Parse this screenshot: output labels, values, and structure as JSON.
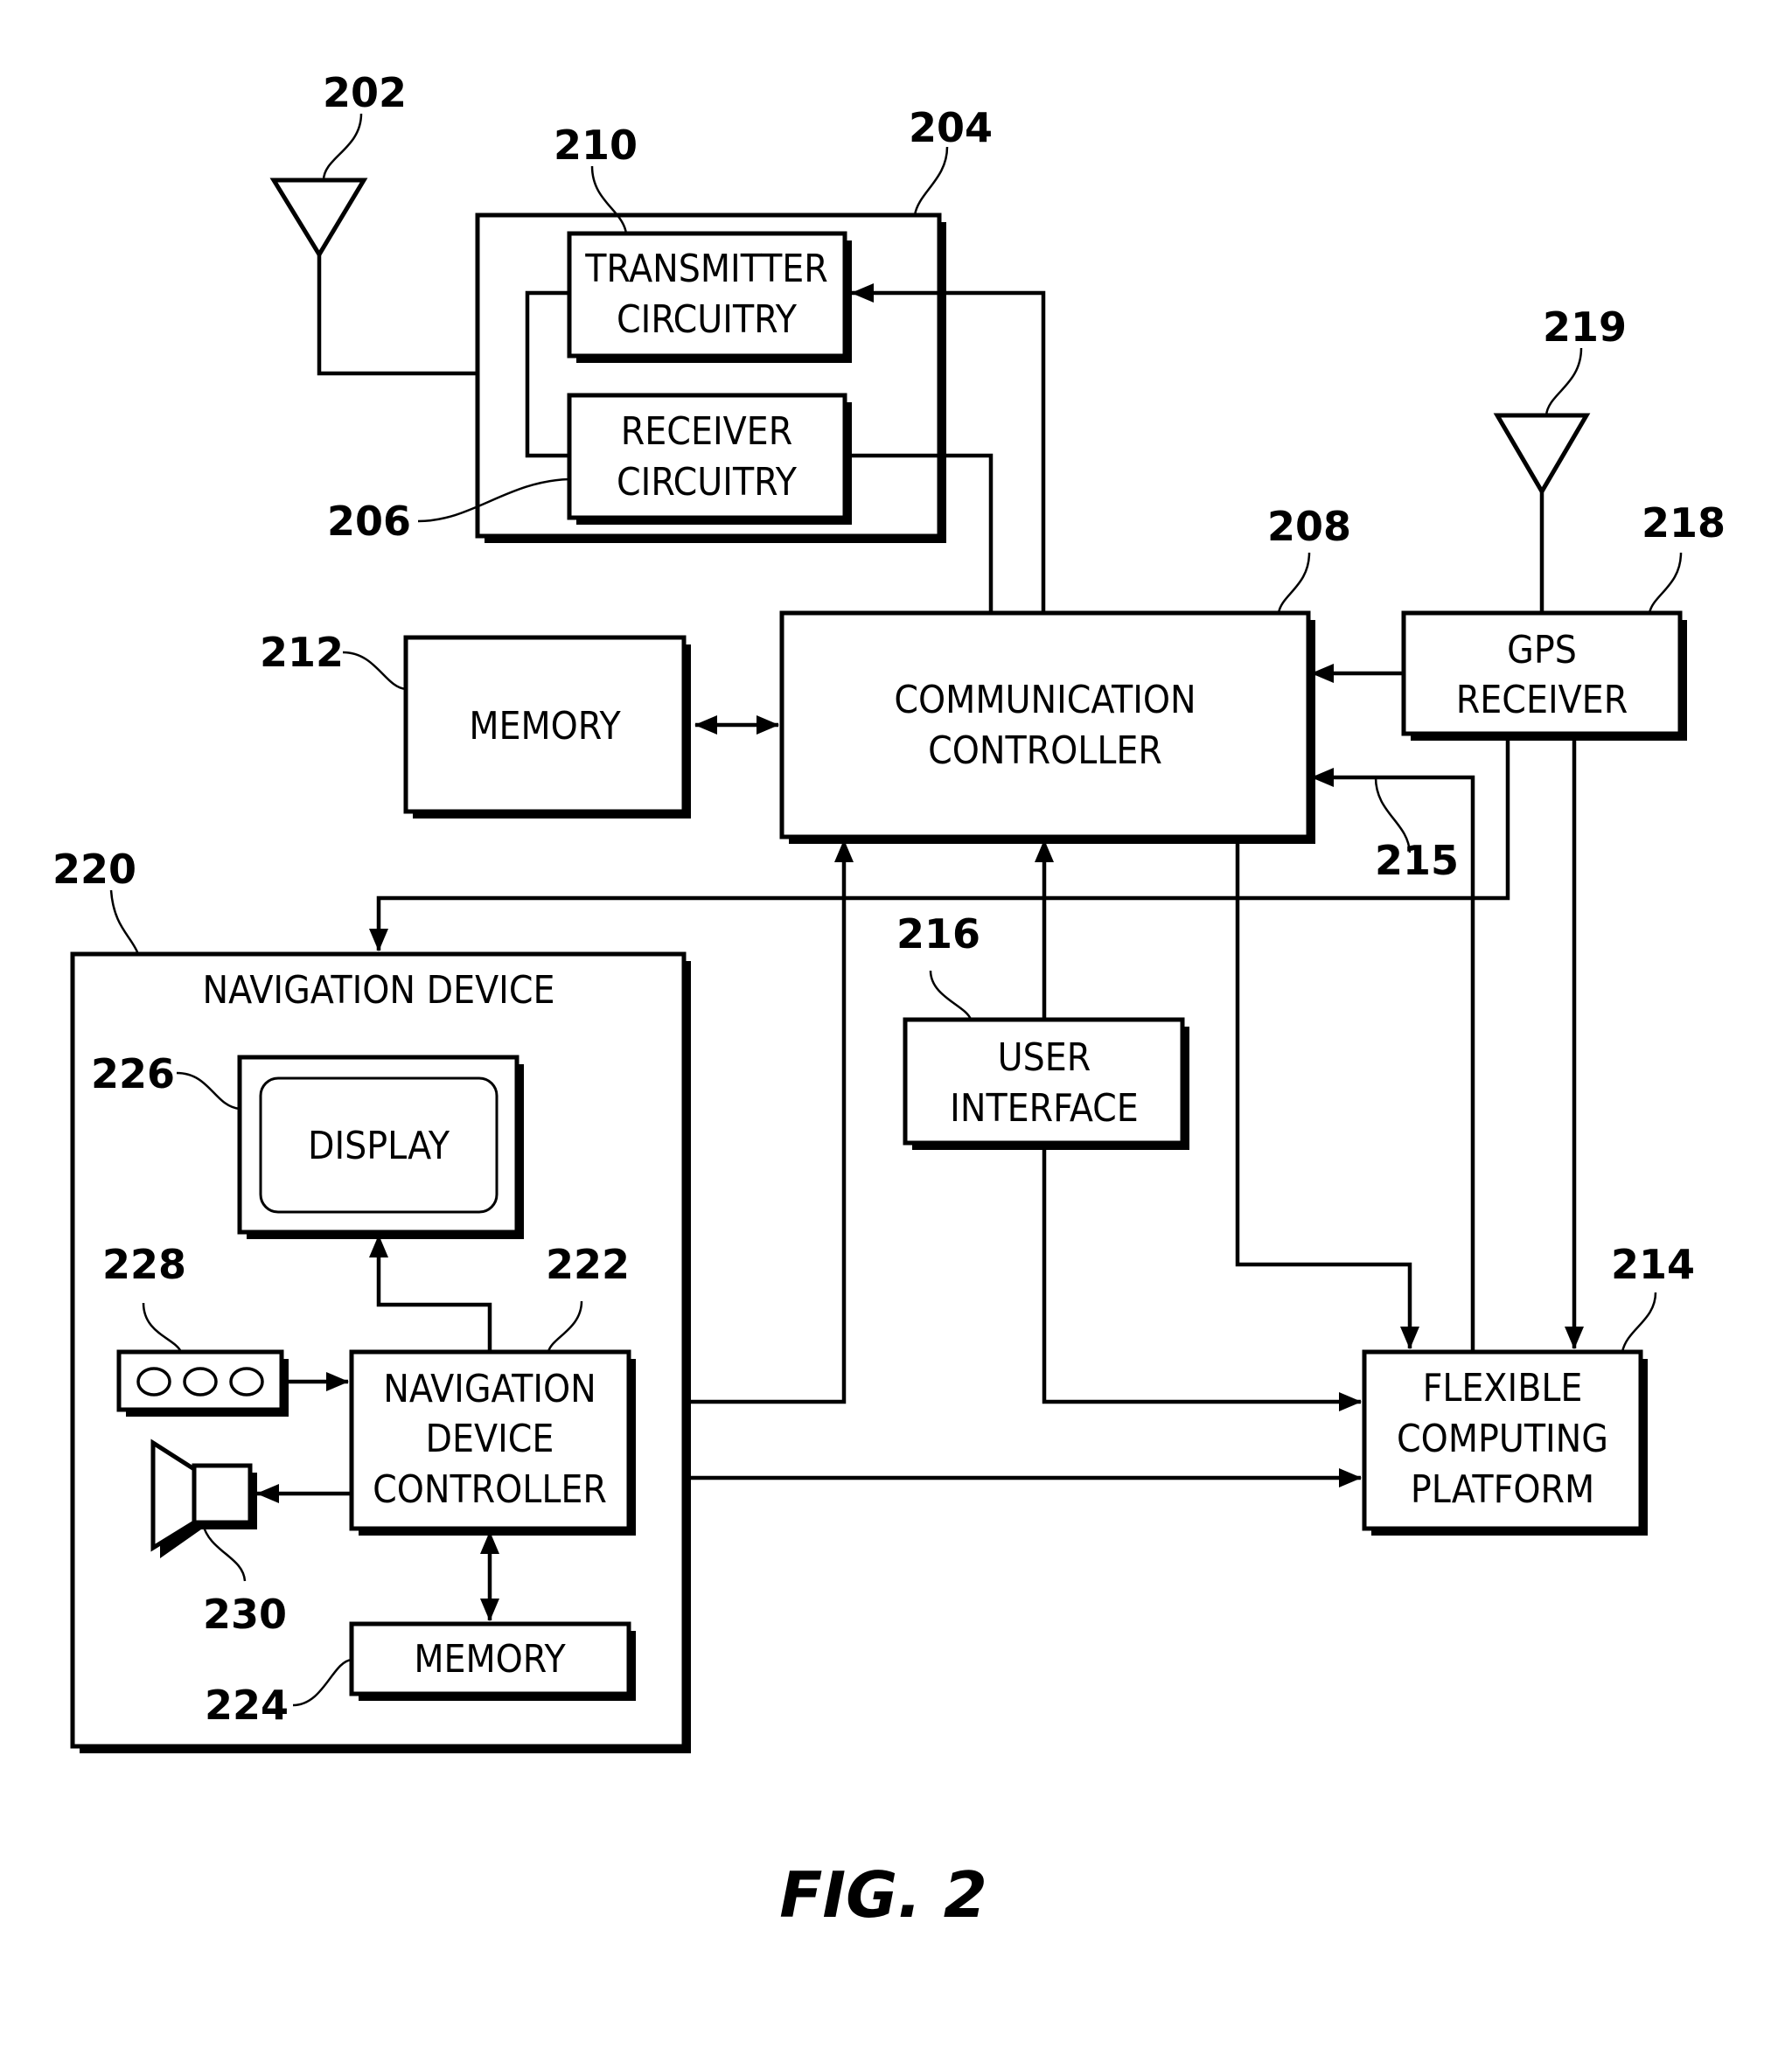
{
  "figure": {
    "caption": "FIG. 2"
  },
  "blocks": {
    "transmitter": {
      "ref": "210",
      "line1": "TRANSMITTER",
      "line2": "CIRCUITRY"
    },
    "receiver": {
      "ref": "206",
      "line1": "RECEIVER",
      "line2": "CIRCUITRY"
    },
    "transceiver": {
      "ref": "204"
    },
    "antenna_comm": {
      "ref": "202"
    },
    "comm_controller": {
      "ref": "208",
      "line1": "COMMUNICATION",
      "line2": "CONTROLLER"
    },
    "memory_main": {
      "ref": "212",
      "label": "MEMORY"
    },
    "gps_receiver": {
      "ref": "218",
      "line1": "GPS",
      "line2": "RECEIVER"
    },
    "antenna_gps": {
      "ref": "219"
    },
    "bus_215": {
      "ref": "215"
    },
    "user_interface": {
      "ref": "216",
      "line1": "USER",
      "line2": "INTERFACE"
    },
    "flexible_platform": {
      "ref": "214",
      "line1": "FLEXIBLE",
      "line2": "COMPUTING",
      "line3": "PLATFORM"
    },
    "navigation_device": {
      "ref": "220",
      "title": "NAVIGATION DEVICE"
    },
    "display": {
      "ref": "226",
      "label": "DISPLAY"
    },
    "keypad": {
      "ref": "228"
    },
    "nav_controller": {
      "ref": "222",
      "line1": "NAVIGATION",
      "line2": "DEVICE",
      "line3": "CONTROLLER"
    },
    "speaker": {
      "ref": "230"
    },
    "memory_nav": {
      "ref": "224",
      "label": "MEMORY"
    }
  }
}
